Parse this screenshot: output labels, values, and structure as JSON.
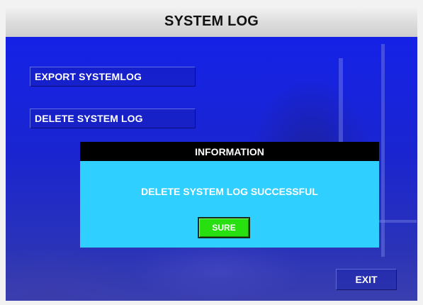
{
  "window": {
    "title": "SYSTEM LOG"
  },
  "menu": {
    "export_label": "EXPORT SYSTEMLOG",
    "delete_label": "DELETE SYSTEM LOG"
  },
  "dialog": {
    "title": "INFORMATION",
    "message": "DELETE SYSTEM LOG SUCCESSFUL",
    "confirm_label": "SURE"
  },
  "footer": {
    "exit_label": "EXIT"
  },
  "colors": {
    "background_blue": "#1420d8",
    "dialog_header": "#000000",
    "dialog_body": "#2fd0ff",
    "confirm_button": "#28e010"
  }
}
